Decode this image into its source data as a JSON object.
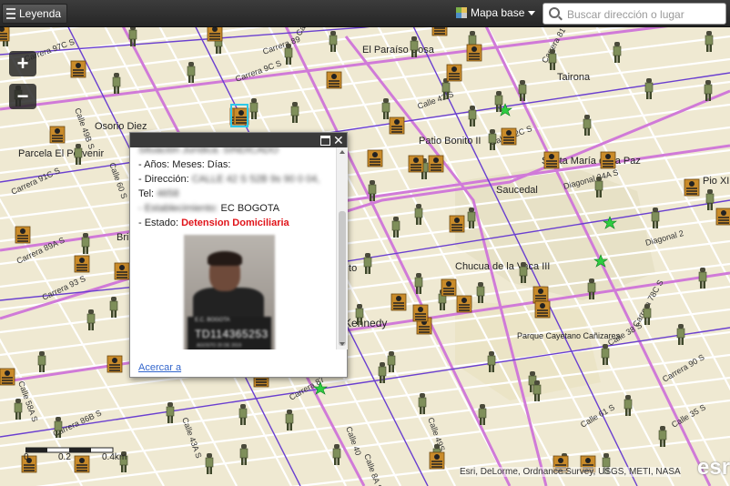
{
  "toolbar": {
    "legend_label": "Leyenda",
    "basemap_label": "Mapa base",
    "search_placeholder": "Buscar dirección o lugar"
  },
  "zoom": {
    "in": "+",
    "out": "−"
  },
  "map": {
    "place_labels": [
      "El Paraíso Bosa",
      "Tairona",
      "Osorio Diez",
      "Parcela El Porvenir",
      "Patio Bonito II",
      "Santa María de la Paz",
      "Saucedal",
      "Pio XII",
      "Chucua de la Vaca III",
      "Parque Cayetano Cañizares",
      "Kennedy",
      "Bri",
      "Bosa",
      "Ito"
    ],
    "street_labels": [
      "Carrera 97C S",
      "Calle 49B S",
      "Calle 43A S",
      "Carrera 91C S",
      "Carrera 89A S",
      "Calle 60 S",
      "Carrera 93 S",
      "Carrera 72",
      "Calle 58A S",
      "Carrera 86B S",
      "Calle 55",
      "Calle 49S",
      "Calle 40",
      "Calle 42 S",
      "Carrera 87",
      "Calle 38 S",
      "Calle 42C S",
      "Diagonal 34A S",
      "Diagonal 2",
      "Calle 43A S",
      "Carrera 78C S",
      "Calle 35 S",
      "Carrera 81 S",
      "Calle 61 S",
      "Carrera 90 S",
      "Calle 38",
      "Calle 43 S",
      "Carrera 9C S",
      "Carrera 89",
      "Calle 8A S",
      "Calle 42 S"
    ],
    "colors": {
      "land": "#efe9d2",
      "minor_road": "#ffffff",
      "major_road": "#d07ad8",
      "boundary": "#6a3fd0",
      "park": "#d7e6bf",
      "selection": "#2ec8e8"
    }
  },
  "popup": {
    "line_1": "Situación Jurídica: SINDICADO",
    "line_2": "- Años:  Meses:  Días:",
    "line_3_label": "- Dirección: ",
    "line_3_value": "CALLE 42 S 52B 9s 90 0 04,",
    "line_4_label": "Tel: ",
    "line_4_value": "4658",
    "line_5_label": "- Establecimiento: ",
    "line_5_value": "EC BOGOTA",
    "line_6_label": "- Estado: ",
    "line_6_value": "Detension Domiciliaria",
    "photo_board": "TD114365253",
    "photo_board_small": "E.C. BOGOTA",
    "photo_date": "AGOSTO 20 DE 2019",
    "link": "Acercar a"
  },
  "scale": {
    "ticks": [
      "0",
      "0.2",
      "0.4km"
    ]
  },
  "attribution": "Esri, DeLorme, Ordnance Survey, USGS, METI, NASA",
  "logo": "esri"
}
